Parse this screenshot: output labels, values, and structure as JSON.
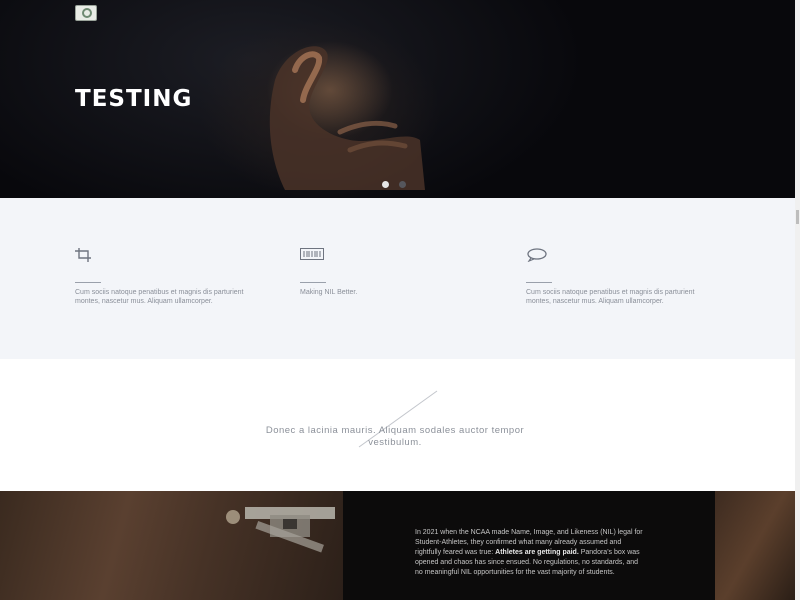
{
  "hero": {
    "title": "TESTING",
    "slides": 2,
    "active_slide": 1
  },
  "features": [
    {
      "icon": "crop-icon",
      "icon_glyph": "⌗",
      "title": "",
      "text": "Cum sociis natoque penatibus et magnis dis parturient montes, nascetur mus. Aliquam ullamcorper."
    },
    {
      "icon": "barcode-icon",
      "icon_glyph": "▥",
      "title": "",
      "text": "Making NIL Better."
    },
    {
      "icon": "chat-bubble-icon",
      "icon_glyph": "◯",
      "title": "",
      "text": "Cum sociis natoque penatibus et magnis dis parturient montes, nascetur mus. Aliquam ullamcorper."
    }
  ],
  "quote": {
    "text": "Donec a lacinia mauris. Aliquam sodales auctor tempor vestibulum."
  },
  "story": {
    "intro": "In 2021 when the NCAA made Name, Image, and Likeness (NIL) legal for Student-Athletes, they confirmed what many already assumed and rightfully feared was true: ",
    "emphasis": "Athletes are getting paid.",
    "rest": " Pandora's box was opened and chaos has since ensued. No regulations, no standards, and no meaningful NIL opportunities for the vast majority of students."
  },
  "colors": {
    "hero_bg": "#08080c",
    "features_bg": "#f3f5f9",
    "text_muted": "#8a8f99"
  }
}
